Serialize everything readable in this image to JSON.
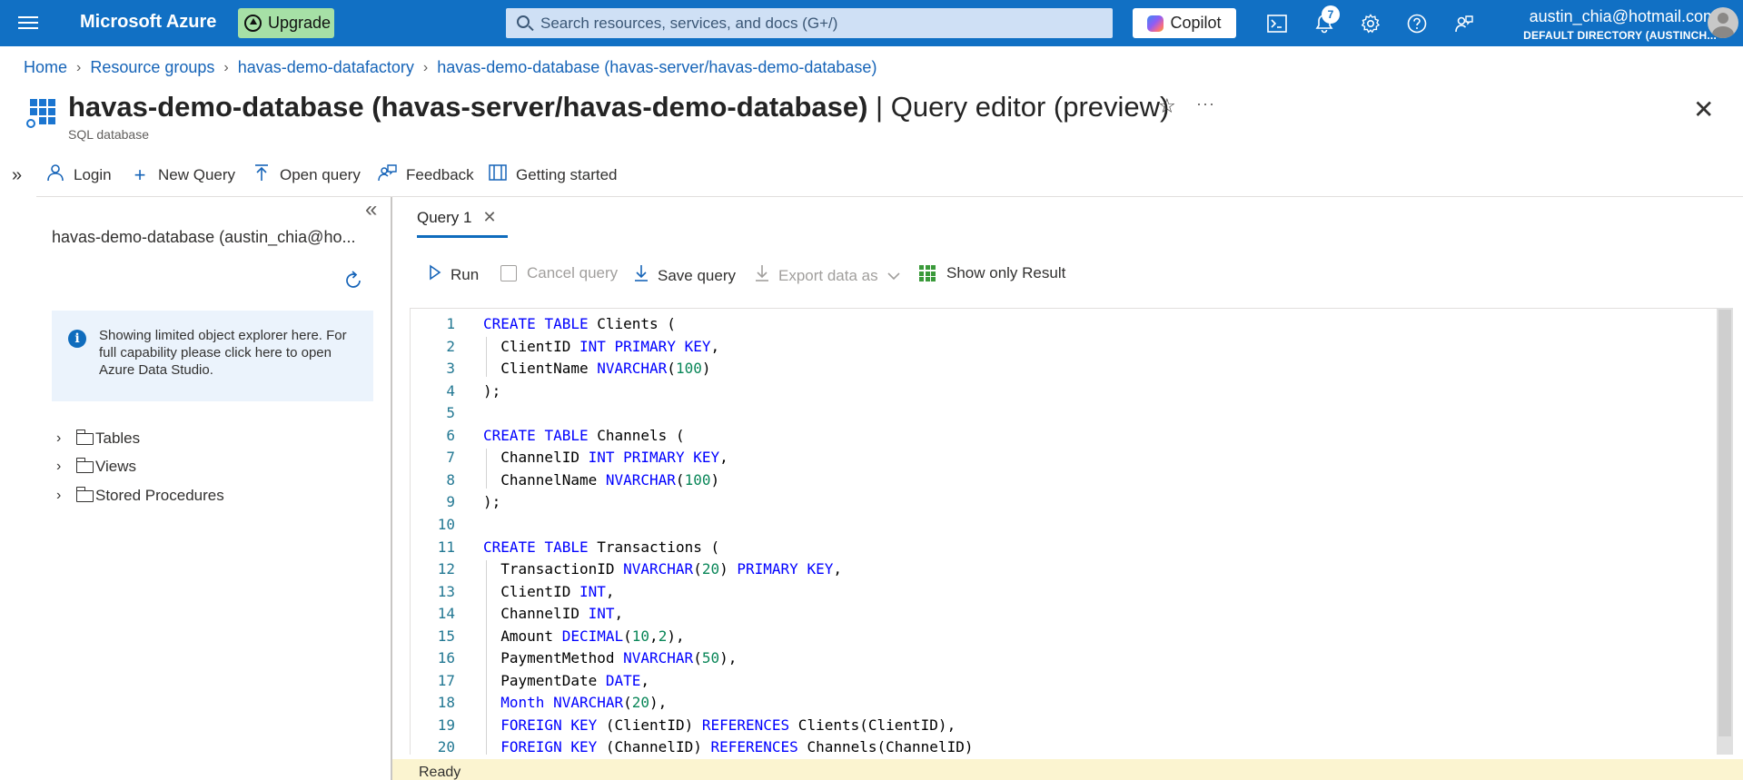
{
  "topbar": {
    "brand": "Microsoft Azure",
    "upgrade_label": "Upgrade",
    "search_placeholder": "Search resources, services, and docs (G+/)",
    "copilot_label": "Copilot",
    "notification_count": "7",
    "account_email": "austin_chia@hotmail.com",
    "account_directory": "DEFAULT DIRECTORY (AUSTINCH...",
    "color": "#1170c4"
  },
  "breadcrumb": [
    "Home",
    "Resource groups",
    "havas-demo-datafactory",
    "havas-demo-database (havas-server/havas-demo-database)"
  ],
  "header": {
    "title_bold": "havas-demo-database (havas-server/havas-demo-database)",
    "title_rest": " | Query editor (preview)",
    "subtitle": "SQL database"
  },
  "commands": {
    "login": "Login",
    "new_query": "New Query",
    "open_query": "Open query",
    "feedback": "Feedback",
    "getting_started": "Getting started"
  },
  "explorer": {
    "database_name": "havas-demo-database (austin_chia@ho...",
    "info_text": "Showing limited object explorer here. For full capability please click here to open Azure Data Studio.",
    "tree": [
      "Tables",
      "Views",
      "Stored Procedures"
    ]
  },
  "editor": {
    "tab_label": "Query 1",
    "run": "Run",
    "cancel_query": "Cancel query",
    "save_query": "Save query",
    "export_data_as": "Export data as",
    "show_only_result": "Show only Result",
    "status": "Ready",
    "lines": [
      {
        "n": "1",
        "code": "CREATE TABLE Clients ("
      },
      {
        "n": "2",
        "code": "  ClientID INT PRIMARY KEY,"
      },
      {
        "n": "3",
        "code": "  ClientName NVARCHAR(100)"
      },
      {
        "n": "4",
        "code": ");"
      },
      {
        "n": "5",
        "code": ""
      },
      {
        "n": "6",
        "code": "CREATE TABLE Channels ("
      },
      {
        "n": "7",
        "code": "  ChannelID INT PRIMARY KEY,"
      },
      {
        "n": "8",
        "code": "  ChannelName NVARCHAR(100)"
      },
      {
        "n": "9",
        "code": ");"
      },
      {
        "n": "10",
        "code": ""
      },
      {
        "n": "11",
        "code": "CREATE TABLE Transactions ("
      },
      {
        "n": "12",
        "code": "  TransactionID NVARCHAR(20) PRIMARY KEY,"
      },
      {
        "n": "13",
        "code": "  ClientID INT,"
      },
      {
        "n": "14",
        "code": "  ChannelID INT,"
      },
      {
        "n": "15",
        "code": "  Amount DECIMAL(10,2),"
      },
      {
        "n": "16",
        "code": "  PaymentMethod NVARCHAR(50),"
      },
      {
        "n": "17",
        "code": "  PaymentDate DATE,"
      },
      {
        "n": "18",
        "code": "  Month NVARCHAR(20),"
      },
      {
        "n": "19",
        "code": "  FOREIGN KEY (ClientID) REFERENCES Clients(ClientID),"
      },
      {
        "n": "20",
        "code": "  FOREIGN KEY (ChannelID) REFERENCES Channels(ChannelID)"
      }
    ]
  }
}
